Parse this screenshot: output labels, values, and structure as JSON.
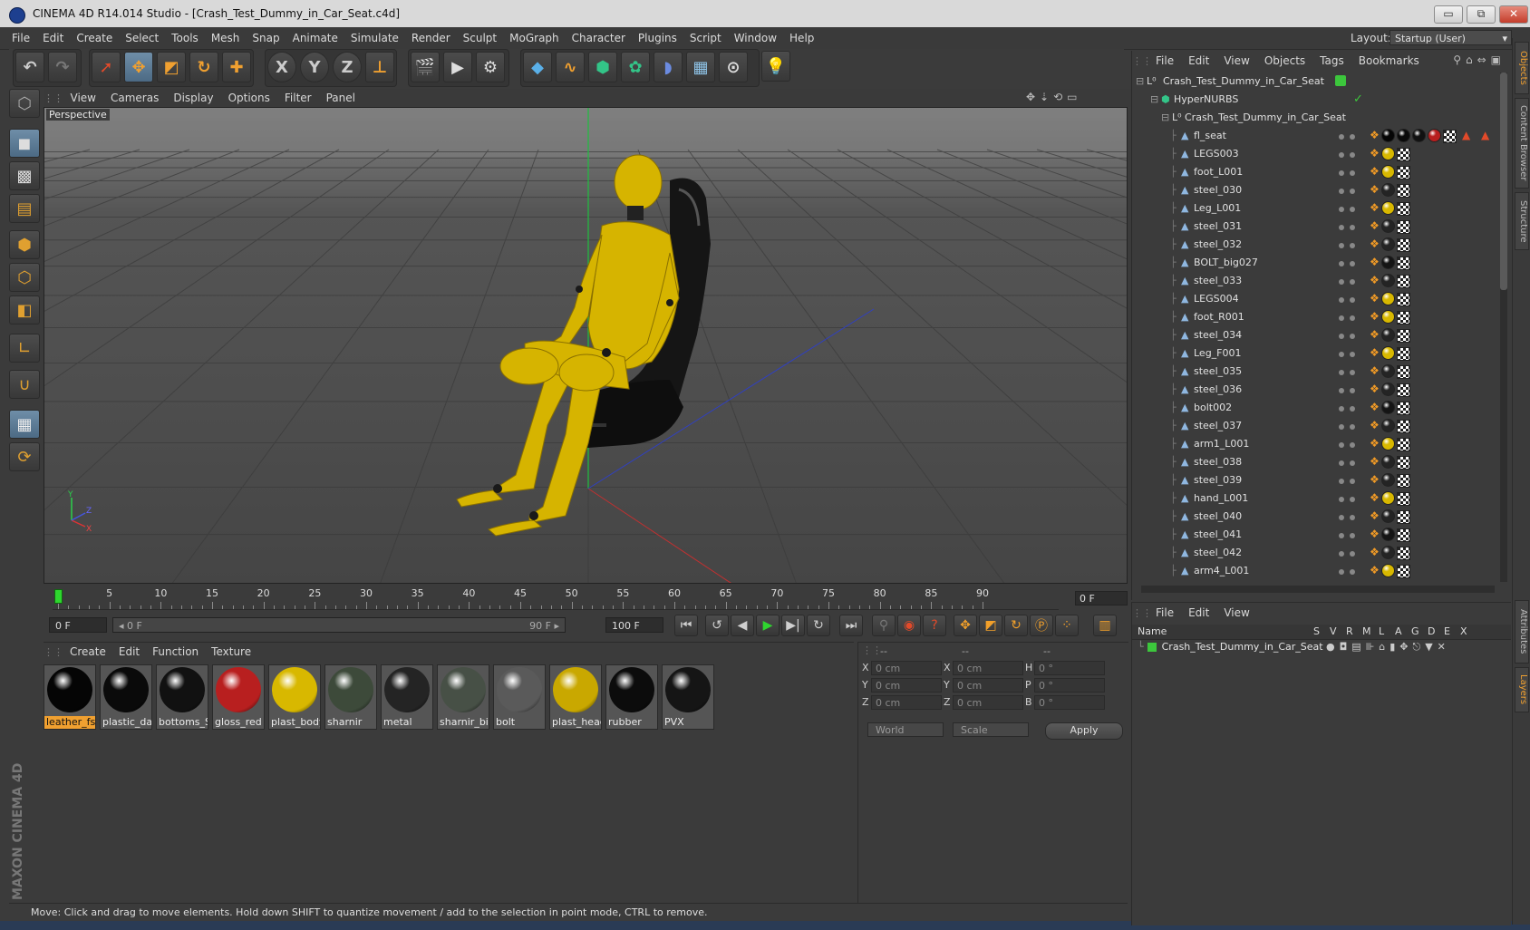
{
  "window": {
    "title": "CINEMA 4D R14.014 Studio - [Crash_Test_Dummy_in_Car_Seat.c4d]",
    "buttons": {
      "minimize": "▭",
      "restore": "⧉",
      "close": "✕"
    }
  },
  "menubar": {
    "items": [
      "File",
      "Edit",
      "Create",
      "Select",
      "Tools",
      "Mesh",
      "Snap",
      "Animate",
      "Simulate",
      "Render",
      "Sculpt",
      "MoGraph",
      "Character",
      "Plugins",
      "Script",
      "Window",
      "Help"
    ],
    "layout_label": "Layout:",
    "layout_value": "Startup (User)"
  },
  "toolbar": {
    "axis_x": "X",
    "axis_y": "Y",
    "axis_z": "Z"
  },
  "viewport": {
    "menu": [
      "View",
      "Cameras",
      "Display",
      "Options",
      "Filter",
      "Panel"
    ],
    "label": "Perspective",
    "axis_labels": {
      "x": "X",
      "y": "Y",
      "z": "Z"
    }
  },
  "timeline": {
    "tick_labels": [
      "0",
      "5",
      "10",
      "15",
      "20",
      "25",
      "30",
      "35",
      "40",
      "45",
      "50",
      "55",
      "60",
      "65",
      "70",
      "75",
      "80",
      "85",
      "90"
    ],
    "current_frame": "0 F"
  },
  "transport": {
    "start_field": "0 F",
    "range_start": "◂ 0 F",
    "range_end": "90 F ▸",
    "end_field": "100 F"
  },
  "materials": {
    "menu": [
      "Create",
      "Edit",
      "Function",
      "Texture"
    ],
    "items": [
      {
        "name": "leather_fse",
        "color": "#050505",
        "selected": true
      },
      {
        "name": "plastic_dar",
        "color": "#0a0a0a",
        "selected": false
      },
      {
        "name": "bottoms_St",
        "color": "#111111",
        "selected": false
      },
      {
        "name": "gloss_red",
        "color": "#b81f1f",
        "selected": false
      },
      {
        "name": "plast_body",
        "color": "#d8b800",
        "selected": false
      },
      {
        "name": "sharnir",
        "color": "#3d4a3a",
        "selected": false
      },
      {
        "name": "metal",
        "color": "#242424",
        "selected": false
      },
      {
        "name": "sharnir_big",
        "color": "#475046",
        "selected": false
      },
      {
        "name": "bolt",
        "color": "#5a5a5a",
        "selected": false
      },
      {
        "name": "plast_head",
        "color": "#c9a800",
        "selected": false
      },
      {
        "name": "rubber",
        "color": "#0c0c0c",
        "selected": false
      },
      {
        "name": "PVX",
        "color": "#151515",
        "selected": false
      }
    ]
  },
  "coordinates": {
    "headers": [
      "--",
      "--",
      "--"
    ],
    "rows": [
      {
        "axis_a": "X",
        "val_a": "0 cm",
        "axis_b": "X",
        "val_b": "0 cm",
        "axis_c": "H",
        "val_c": "0 °"
      },
      {
        "axis_a": "Y",
        "val_a": "0 cm",
        "axis_b": "Y",
        "val_b": "0 cm",
        "axis_c": "P",
        "val_c": "0 °"
      },
      {
        "axis_a": "Z",
        "val_a": "0 cm",
        "axis_b": "Z",
        "val_b": "0 cm",
        "axis_c": "B",
        "val_c": "0 °"
      }
    ],
    "mode_select": "World",
    "size_select": "Scale",
    "apply_label": "Apply"
  },
  "statusbar": {
    "text": "Move: Click and drag to move elements. Hold down SHIFT to quantize movement / add to the selection in point mode, CTRL to remove."
  },
  "objects": {
    "menu": [
      "File",
      "Edit",
      "View",
      "Objects",
      "Tags",
      "Bookmarks"
    ],
    "root": "Crash_Test_Dummy_in_Car_Seat",
    "hypernurbs": "HyperNURBS",
    "group": "Crash_Test_Dummy_in_Car_Seat",
    "children": [
      {
        "name": "fl_seat",
        "tags": [
          "#050505",
          "#0a0a0a",
          "#111111",
          "#b81f1f"
        ]
      },
      {
        "name": "LEGS003",
        "tags": [
          "#d8b800"
        ]
      },
      {
        "name": "foot_L001",
        "tags": [
          "#d8b800"
        ]
      },
      {
        "name": "steel_030",
        "tags": [
          "#242424"
        ]
      },
      {
        "name": "Leg_L001",
        "tags": [
          "#d8b800"
        ]
      },
      {
        "name": "steel_031",
        "tags": [
          "#242424"
        ]
      },
      {
        "name": "steel_032",
        "tags": [
          "#242424"
        ]
      },
      {
        "name": "BOLT_big027",
        "tags": [
          "#151515"
        ]
      },
      {
        "name": "steel_033",
        "tags": [
          "#242424"
        ]
      },
      {
        "name": "LEGS004",
        "tags": [
          "#d8b800"
        ]
      },
      {
        "name": "foot_R001",
        "tags": [
          "#d8b800"
        ]
      },
      {
        "name": "steel_034",
        "tags": [
          "#242424"
        ]
      },
      {
        "name": "Leg_F001",
        "tags": [
          "#d8b800"
        ]
      },
      {
        "name": "steel_035",
        "tags": [
          "#242424"
        ]
      },
      {
        "name": "steel_036",
        "tags": [
          "#242424"
        ]
      },
      {
        "name": "bolt002",
        "tags": [
          "#151515"
        ]
      },
      {
        "name": "steel_037",
        "tags": [
          "#242424"
        ]
      },
      {
        "name": "arm1_L001",
        "tags": [
          "#d8b800"
        ]
      },
      {
        "name": "steel_038",
        "tags": [
          "#242424"
        ]
      },
      {
        "name": "steel_039",
        "tags": [
          "#242424"
        ]
      },
      {
        "name": "hand_L001",
        "tags": [
          "#d8b800"
        ]
      },
      {
        "name": "steel_040",
        "tags": [
          "#242424"
        ]
      },
      {
        "name": "steel_041",
        "tags": [
          "#151515"
        ]
      },
      {
        "name": "steel_042",
        "tags": [
          "#242424"
        ]
      },
      {
        "name": "arm4_L001",
        "tags": [
          "#d8b800"
        ]
      }
    ]
  },
  "layers": {
    "menu": [
      "File",
      "Edit",
      "View"
    ],
    "columns": [
      "Name",
      "S",
      "V",
      "R",
      "M",
      "L",
      "A",
      "G",
      "D",
      "E",
      "X"
    ],
    "row_name": "Crash_Test_Dummy_in_Car_Seat"
  },
  "right_tabs": [
    "Objects",
    "Content Browser",
    "Structure",
    "Attributes",
    "Layers"
  ],
  "branding": "MAXON CINEMA 4D",
  "colors": {
    "accent": "#f0a030",
    "selection_blue": "#6f8ea8",
    "green": "#3cc63c"
  }
}
